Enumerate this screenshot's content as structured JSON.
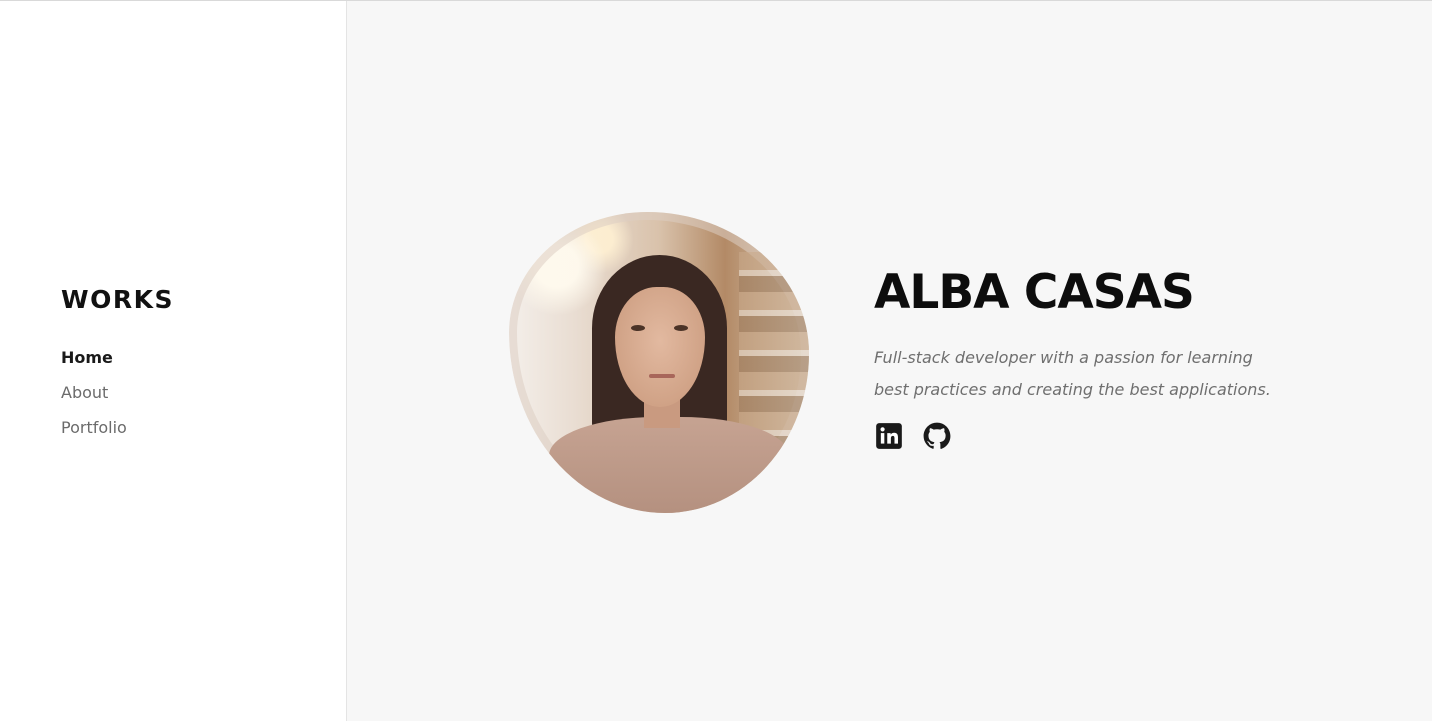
{
  "sidebar": {
    "logo": "WORKS",
    "nav": [
      {
        "label": "Home",
        "active": true
      },
      {
        "label": "About",
        "active": false
      },
      {
        "label": "Portfolio",
        "active": false
      }
    ]
  },
  "hero": {
    "name": "ALBA CASAS",
    "tagline": "Full-stack developer with a passion for learning best practices and creating the best applications.",
    "social": [
      {
        "icon": "linkedin-icon"
      },
      {
        "icon": "github-icon"
      }
    ]
  },
  "colors": {
    "background": "#f7f7f7",
    "sidebar": "#ffffff",
    "text": "#0d0d0d",
    "muted": "#6f6f6f"
  }
}
